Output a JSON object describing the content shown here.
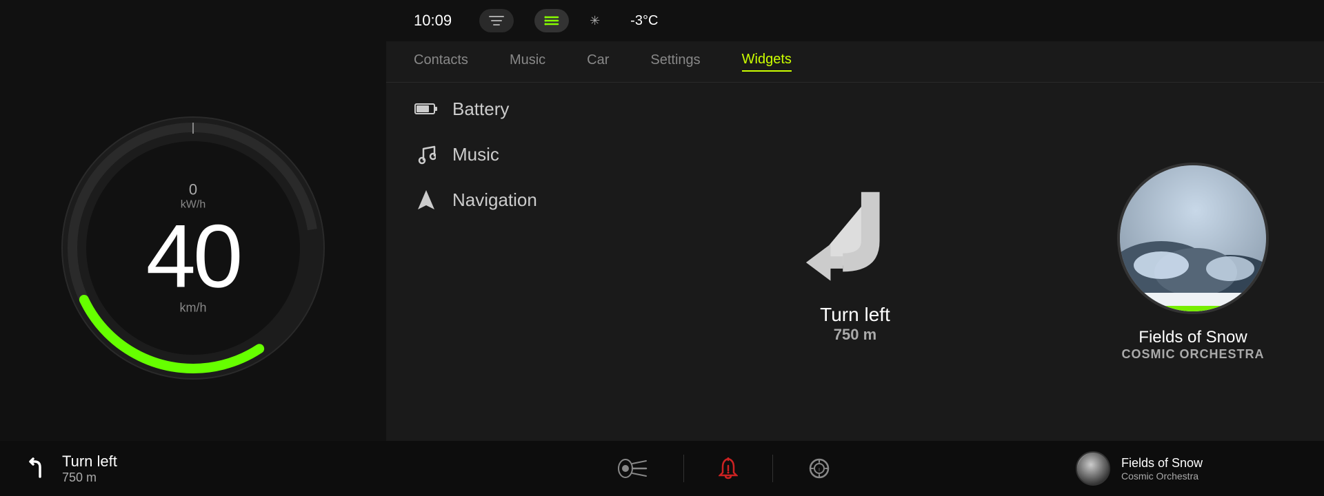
{
  "time": "10:09",
  "temperature": "-3°C",
  "nav_tabs": [
    {
      "label": "Contacts",
      "active": false
    },
    {
      "label": "Music",
      "active": false
    },
    {
      "label": "Car",
      "active": false
    },
    {
      "label": "Settings",
      "active": false
    },
    {
      "label": "Widgets",
      "active": true
    }
  ],
  "widget_items": [
    {
      "label": "Battery",
      "icon": "battery"
    },
    {
      "label": "Music",
      "icon": "music"
    },
    {
      "label": "Navigation",
      "icon": "navigation"
    }
  ],
  "speedometer": {
    "speed": "40",
    "speed_unit": "km/h",
    "kwh": "0",
    "kwh_unit": "kW/h"
  },
  "navigation": {
    "direction": "Turn left",
    "distance": "750 m"
  },
  "music": {
    "song": "Fields of Snow",
    "artist": "COSMIC ORCHESTRA",
    "artist_small": "Cosmic Orchestra"
  },
  "status_icons": {
    "lights": "headlights",
    "warning": "bell-warning",
    "tire": "tire-pressure"
  },
  "bottom_left": {
    "direction": "Turn left",
    "distance": "750 m"
  }
}
